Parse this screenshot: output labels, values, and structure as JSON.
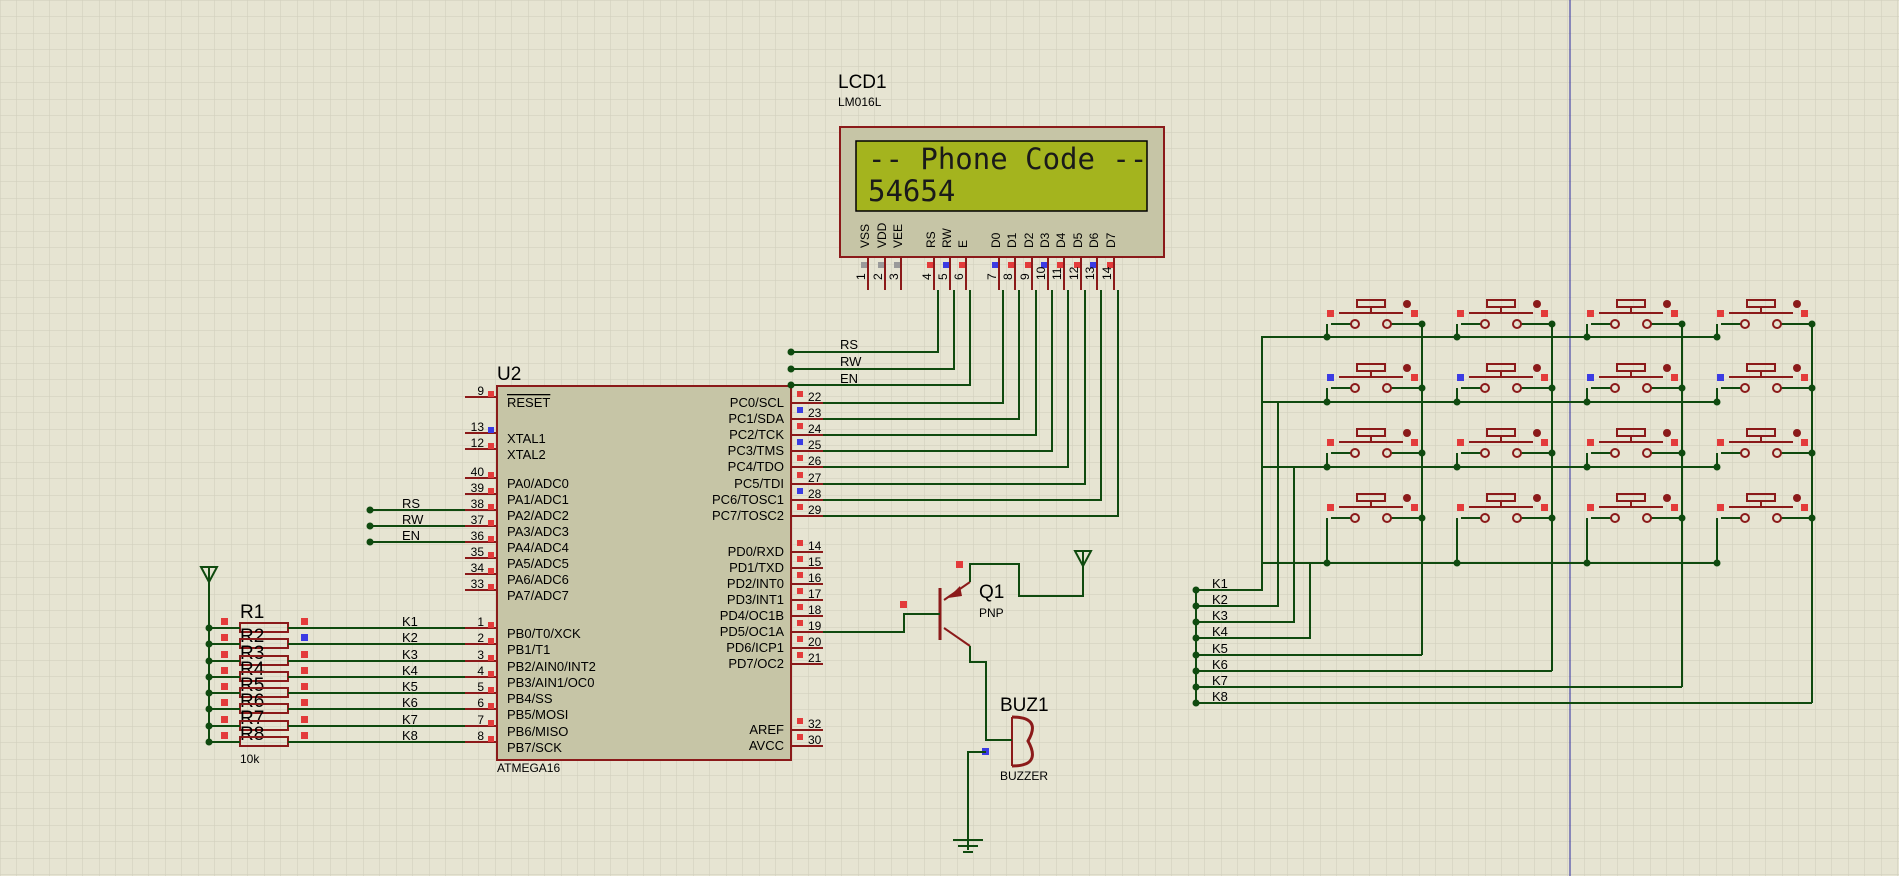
{
  "lcd": {
    "ref": "LCD1",
    "part": "LM016L",
    "line1": "-- Phone Code --",
    "line2": "54654",
    "pins": [
      {
        "name": "VSS",
        "num": "1"
      },
      {
        "name": "VDD",
        "num": "2"
      },
      {
        "name": "VEE",
        "num": "3"
      },
      {
        "name": "RS",
        "num": "4"
      },
      {
        "name": "RW",
        "num": "5"
      },
      {
        "name": "E",
        "num": "6"
      },
      {
        "name": "D0",
        "num": "7"
      },
      {
        "name": "D1",
        "num": "8"
      },
      {
        "name": "D2",
        "num": "9"
      },
      {
        "name": "D3",
        "num": "10"
      },
      {
        "name": "D4",
        "num": "11"
      },
      {
        "name": "D5",
        "num": "12"
      },
      {
        "name": "D6",
        "num": "13"
      },
      {
        "name": "D7",
        "num": "14"
      }
    ],
    "net_labels": [
      "RS",
      "RW",
      "EN"
    ]
  },
  "mcu": {
    "ref": "U2",
    "part": "ATMEGA16",
    "left_pins": [
      {
        "name": "RESET",
        "num": "9"
      },
      {
        "name": "XTAL1",
        "num": "13"
      },
      {
        "name": "XTAL2",
        "num": "12"
      },
      {
        "name": "PA0/ADC0",
        "num": "40"
      },
      {
        "name": "PA1/ADC1",
        "num": "39"
      },
      {
        "name": "PA2/ADC2",
        "num": "38"
      },
      {
        "name": "PA3/ADC3",
        "num": "37"
      },
      {
        "name": "PA4/ADC4",
        "num": "36"
      },
      {
        "name": "PA5/ADC5",
        "num": "35"
      },
      {
        "name": "PA6/ADC6",
        "num": "34"
      },
      {
        "name": "PA7/ADC7",
        "num": "33"
      },
      {
        "name": "PB0/T0/XCK",
        "num": "1"
      },
      {
        "name": "PB1/T1",
        "num": "2"
      },
      {
        "name": "PB2/AIN0/INT2",
        "num": "3"
      },
      {
        "name": "PB3/AIN1/OC0",
        "num": "4"
      },
      {
        "name": "PB4/SS",
        "num": "5"
      },
      {
        "name": "PB5/MOSI",
        "num": "6"
      },
      {
        "name": "PB6/MISO",
        "num": "7"
      },
      {
        "name": "PB7/SCK",
        "num": "8"
      }
    ],
    "right_pins": [
      {
        "name": "PC0/SCL",
        "num": "22"
      },
      {
        "name": "PC1/SDA",
        "num": "23"
      },
      {
        "name": "PC2/TCK",
        "num": "24"
      },
      {
        "name": "PC3/TMS",
        "num": "25"
      },
      {
        "name": "PC4/TDO",
        "num": "26"
      },
      {
        "name": "PC5/TDI",
        "num": "27"
      },
      {
        "name": "PC6/TOSC1",
        "num": "28"
      },
      {
        "name": "PC7/TOSC2",
        "num": "29"
      },
      {
        "name": "PD0/RXD",
        "num": "14"
      },
      {
        "name": "PD1/TXD",
        "num": "15"
      },
      {
        "name": "PD2/INT0",
        "num": "16"
      },
      {
        "name": "PD3/INT1",
        "num": "17"
      },
      {
        "name": "PD4/OC1B",
        "num": "18"
      },
      {
        "name": "PD5/OC1A",
        "num": "19"
      },
      {
        "name": "PD6/ICP1",
        "num": "20"
      },
      {
        "name": "PD7/OC2",
        "num": "21"
      },
      {
        "name": "AREF",
        "num": "32"
      },
      {
        "name": "AVCC",
        "num": "30"
      }
    ],
    "pa_labels": [
      "RS",
      "RW",
      "EN"
    ],
    "pb_labels": [
      "K1",
      "K2",
      "K3",
      "K4",
      "K5",
      "K6",
      "K7",
      "K8"
    ]
  },
  "resistor_pack": {
    "refs": [
      "R1",
      "R2",
      "R3",
      "R4",
      "R5",
      "R6",
      "R7",
      "R8"
    ],
    "value": "10k"
  },
  "transistor": {
    "ref": "Q1",
    "type": "PNP"
  },
  "buzzer": {
    "ref": "BUZ1",
    "part": "BUZZER"
  },
  "keypad": {
    "rows": 4,
    "cols": 4,
    "labels": [
      "K1",
      "K2",
      "K3",
      "K4",
      "K5",
      "K6",
      "K7",
      "K8"
    ]
  },
  "colors": {
    "background": "#e6e4d2",
    "grid": "#cfcdbb",
    "wire": "#0f4a0f",
    "component": "#8b1a1a",
    "chip_fill": "#c6c5a6",
    "lcd_screen": "#a4b41e",
    "pin_red": "#e33b3b",
    "pin_blue": "#3b3be3",
    "pin_grey": "#9a9a9a",
    "cursor_line": "#2a2aa0"
  }
}
